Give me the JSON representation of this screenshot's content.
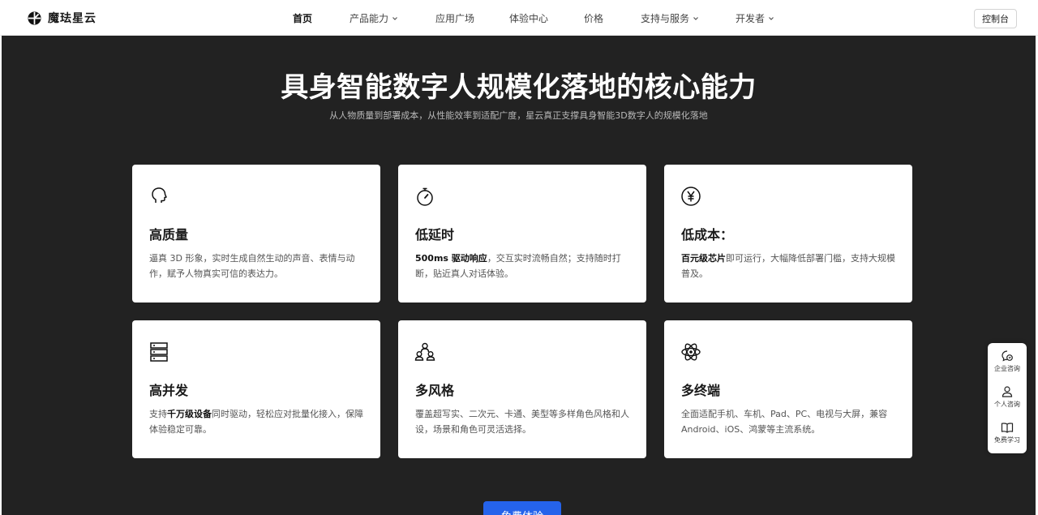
{
  "header": {
    "brand": "魔珐星云",
    "nav": [
      {
        "label": "首页",
        "dropdown": false,
        "active": true
      },
      {
        "label": "产品能力",
        "dropdown": true,
        "active": false
      },
      {
        "label": "应用广场",
        "dropdown": false,
        "active": false
      },
      {
        "label": "体验中心",
        "dropdown": false,
        "active": false
      },
      {
        "label": "价格",
        "dropdown": false,
        "active": false
      },
      {
        "label": "支持与服务",
        "dropdown": true,
        "active": false
      },
      {
        "label": "开发者",
        "dropdown": true,
        "active": false
      }
    ],
    "console_button": "控制台"
  },
  "hero": {
    "title": "具身智能数字人规模化落地的核心能力",
    "subtitle": "从人物质量到部署成本，从性能效率到适配广度，星云真正支撑具身智能3D数字人的规模化落地"
  },
  "cards": [
    {
      "icon": "head-icon",
      "title": "高质量",
      "bold": "",
      "desc": "逼真 3D 形象，实时生成自然生动的声音、表情与动作，赋予人物真实可信的表达力。"
    },
    {
      "icon": "stopwatch-icon",
      "title": "低延时",
      "bold": "500ms 驱动响应",
      "desc": "，交互实时流畅自然；支持随时打断，贴近真人对话体验。"
    },
    {
      "icon": "yen-icon",
      "title": "低成本：",
      "bold": "百元级芯片",
      "desc": "即可运行，大幅降低部署门槛，支持大规模普及。"
    },
    {
      "icon": "server-icon",
      "title": "高并发",
      "bold": "千万级设备",
      "desc": "同时驱动，轻松应对批量化接入，保障体验稳定可靠。",
      "prefix": "支持"
    },
    {
      "icon": "people-icon",
      "title": "多风格",
      "bold": "",
      "desc": "覆盖超写实、二次元、卡通、美型等多样角色风格和人设，场景和角色可灵活选择。"
    },
    {
      "icon": "atom-icon",
      "title": "多终端",
      "bold": "",
      "desc": "全面适配手机、车机、Pad、PC、电视与大屏，兼容 Android、iOS、鸿蒙等主流系统。"
    }
  ],
  "cta_label": "免费体验",
  "float_bar": [
    {
      "icon": "chat-icon",
      "label": "企业咨询"
    },
    {
      "icon": "person-icon",
      "label": "个人咨询"
    },
    {
      "icon": "book-icon",
      "label": "免费学习"
    }
  ],
  "colors": {
    "hero_bg": "#222222",
    "cta": "#2563eb"
  }
}
